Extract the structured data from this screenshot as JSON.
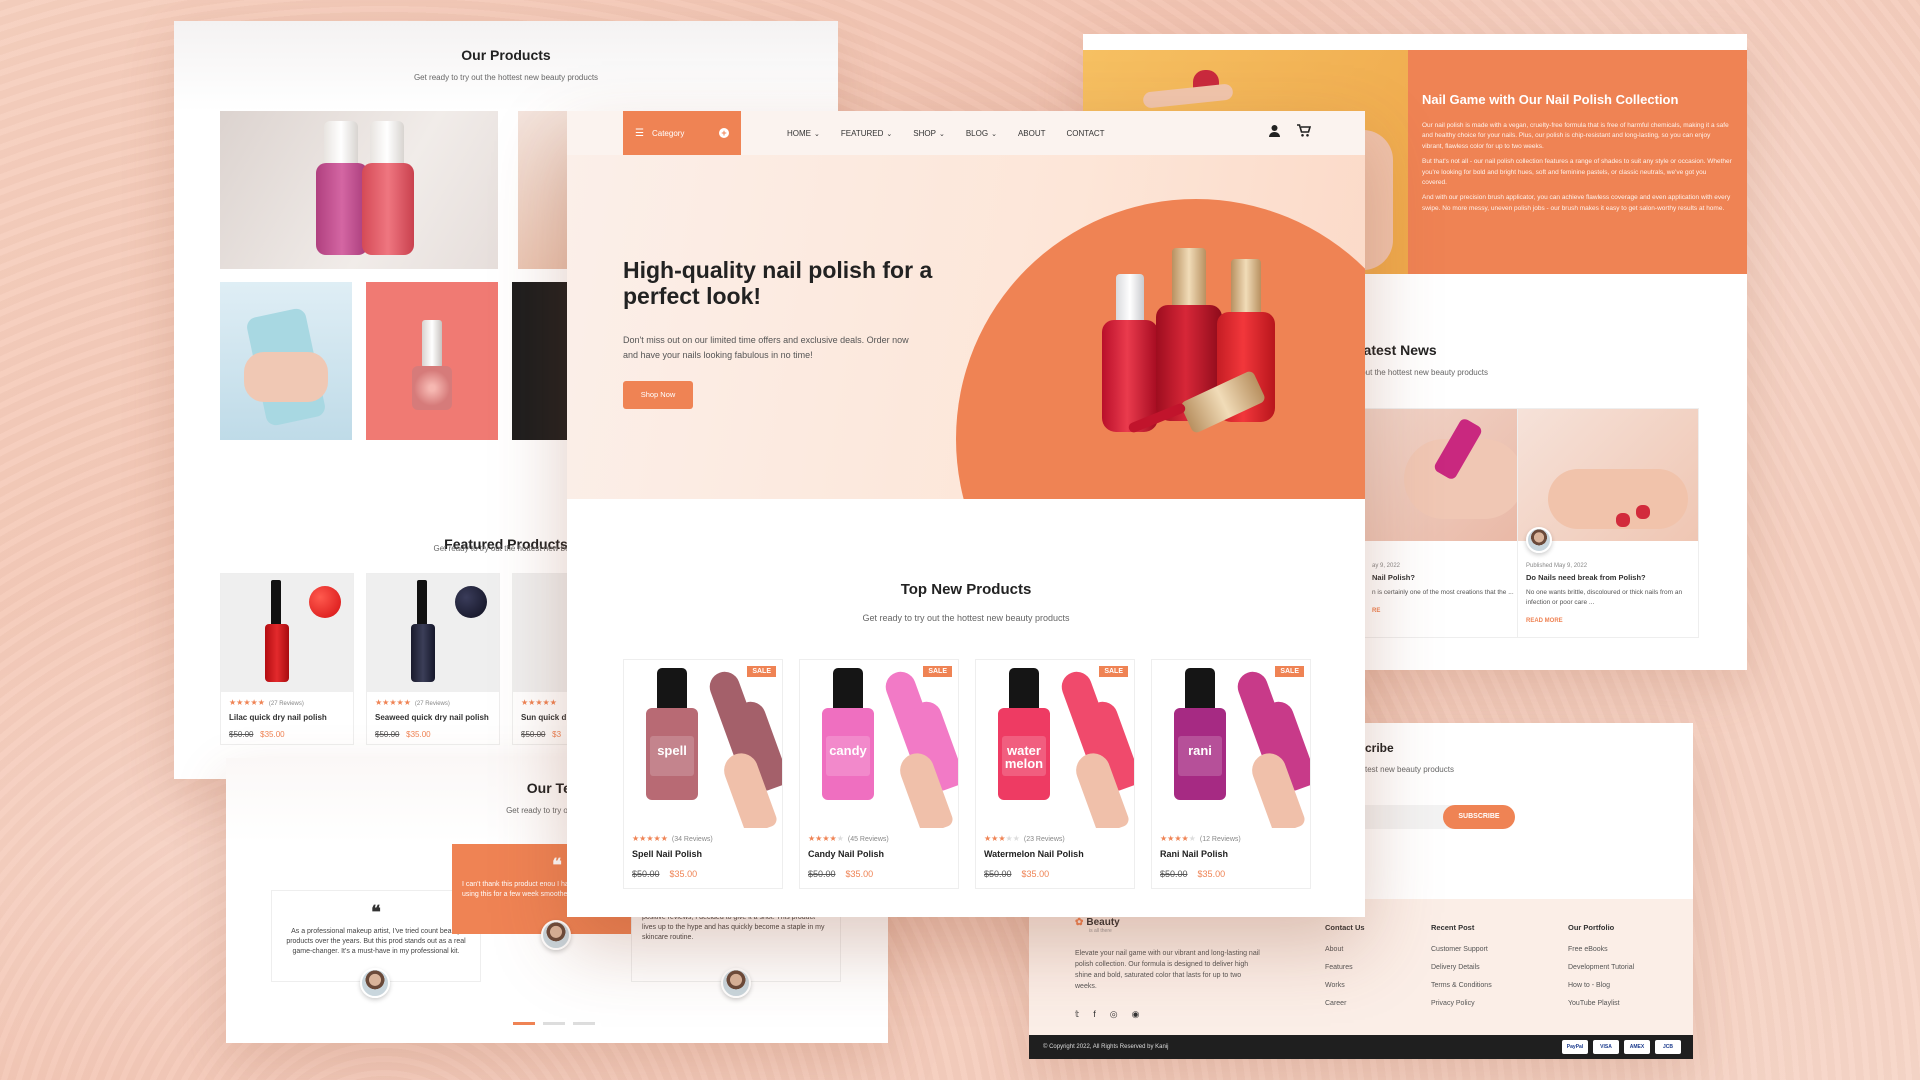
{
  "colors": {
    "accent": "#ef8354",
    "dark": "#1f1f1f"
  },
  "products_card": {
    "title": "Our Products",
    "subtitle": "Get ready to try out the hottest new beauty products",
    "featured_title": "Featured Products",
    "featured_subtitle": "Get ready to try out the hottest new beau",
    "featured": [
      {
        "name": "Lilac quick dry nail polish",
        "reviews": "(27 Reviews)",
        "old": "$50.00",
        "new": "$35.00"
      },
      {
        "name": "Seaweed quick dry nail polish",
        "reviews": "(27 Reviews)",
        "old": "$50.00",
        "new": "$35.00"
      },
      {
        "name": "Sun quick d",
        "reviews": "",
        "old": "$50.00",
        "new": "$3"
      }
    ]
  },
  "testimonials": {
    "title": "Our Testi",
    "subtitle": "Get ready to try out the hotte",
    "t1": "As a professional makeup artist, I've tried count beauty products over the years. But this prod stands out as a real game-changer. It's a must-have in my professional kit.",
    "t2": "I can't thank this product enou I have struggled with acne-p using this for a few week smoother, and more radia",
    "t3": "s hesitant to try this product at first, but after so many positive reviews, I decided to give it a shot. This product lives up to the hype and has quickly become a staple in my skincare routine."
  },
  "nail_game": {
    "title": "Nail Game with Our Nail Polish Collection",
    "p1": "Our nail polish is made with a vegan, cruelty-free formula that is free of harmful chemicals, making it a safe and healthy choice for your nails. Plus, our polish is chip-resistant and long-lasting, so you can enjoy vibrant, flawless color for up to two weeks.",
    "p2": "But that's not all - our nail polish collection features a range of shades to suit any style or occasion. Whether you're looking for bold and bright hues, soft and feminine pastels, or classic neutrals, we've got you covered.",
    "p3": "And with our precision brush applicator, you can achieve flawless coverage and even application with every swipe. No more messy, uneven polish jobs - our brush makes it easy to get salon-worthy results at home."
  },
  "news": {
    "title": "Latest News",
    "subtitle": "y out the hottest new beauty products",
    "items": [
      {
        "date": "ay 9, 2022",
        "title": "Nail Polish?",
        "excerpt": "n is certainly one of the most creations that the ...",
        "more": "RE"
      },
      {
        "date": "Published May 9, 2022",
        "title": "Do Nails need break from Polish?",
        "excerpt": "No one wants brittle, discoloured or thick nails from an infection or poor care ...",
        "more": "READ MORE"
      }
    ]
  },
  "subscribe": {
    "title": "cribe",
    "subtitle": "test new beauty products",
    "button": "SUBSCRIBE"
  },
  "footer": {
    "brand": "Beauty",
    "tagline": "is all there",
    "desc": "Elevate your nail game with our vibrant and long-lasting nail polish collection. Our formula is designed to deliver high shine and bold, saturated color that lasts for up to two weeks.",
    "contact_h": "Contact Us",
    "contact": [
      "About",
      "Features",
      "Works",
      "Career"
    ],
    "recent_h": "Recent Post",
    "recent": [
      "Customer Support",
      "Delivery Details",
      "Terms & Conditions",
      "Privacy Policy"
    ],
    "portfolio_h": "Our Portfolio",
    "portfolio": [
      "Free eBooks",
      "Development Tutorial",
      "How to - Blog",
      "YouTube Playlist"
    ],
    "copyright": "© Copyright 2022, All Rights Reserved by Kanij",
    "payments": [
      "PayPal",
      "VISA",
      "AMEX",
      "JCB"
    ]
  },
  "main": {
    "category_label": "Category",
    "menu": [
      "HOME",
      "FEATURED",
      "SHOP",
      "BLOG",
      "ABOUT",
      "CONTACT"
    ],
    "hero_title": "High-quality nail polish for a perfect look!",
    "hero_text": "Don't miss out on our limited time offers and exclusive deals. Order now and have your nails looking fabulous in no time!",
    "shop_button": "Shop Now",
    "top_title": "Top New Products",
    "top_sub": "Get ready to try out the hottest new beauty products",
    "sale": "SALE",
    "products": [
      {
        "name": "Spell Nail Polish",
        "label": "spell",
        "reviews": "(34 Reviews)",
        "rating": 5,
        "old": "$50.00",
        "new": "$35.00",
        "color": "#b86a74",
        "finger": "#a4606a"
      },
      {
        "name": "Candy Nail Polish",
        "label": "candy",
        "reviews": "(45 Reviews)",
        "rating": 4,
        "old": "$50.00",
        "new": "$35.00",
        "color": "#ef6fc0",
        "finger": "#f27ac6"
      },
      {
        "name": "Watermelon Nail Polish",
        "label": "water melon",
        "reviews": "(23 Reviews)",
        "rating": 3,
        "old": "$50.00",
        "new": "$35.00",
        "color": "#ee3b63",
        "finger": "#f04a6c"
      },
      {
        "name": "Rani Nail Polish",
        "label": "rani",
        "reviews": "(12 Reviews)",
        "rating": 4,
        "old": "$50.00",
        "new": "$35.00",
        "color": "#a62a83",
        "finger": "#c83a89"
      }
    ]
  }
}
